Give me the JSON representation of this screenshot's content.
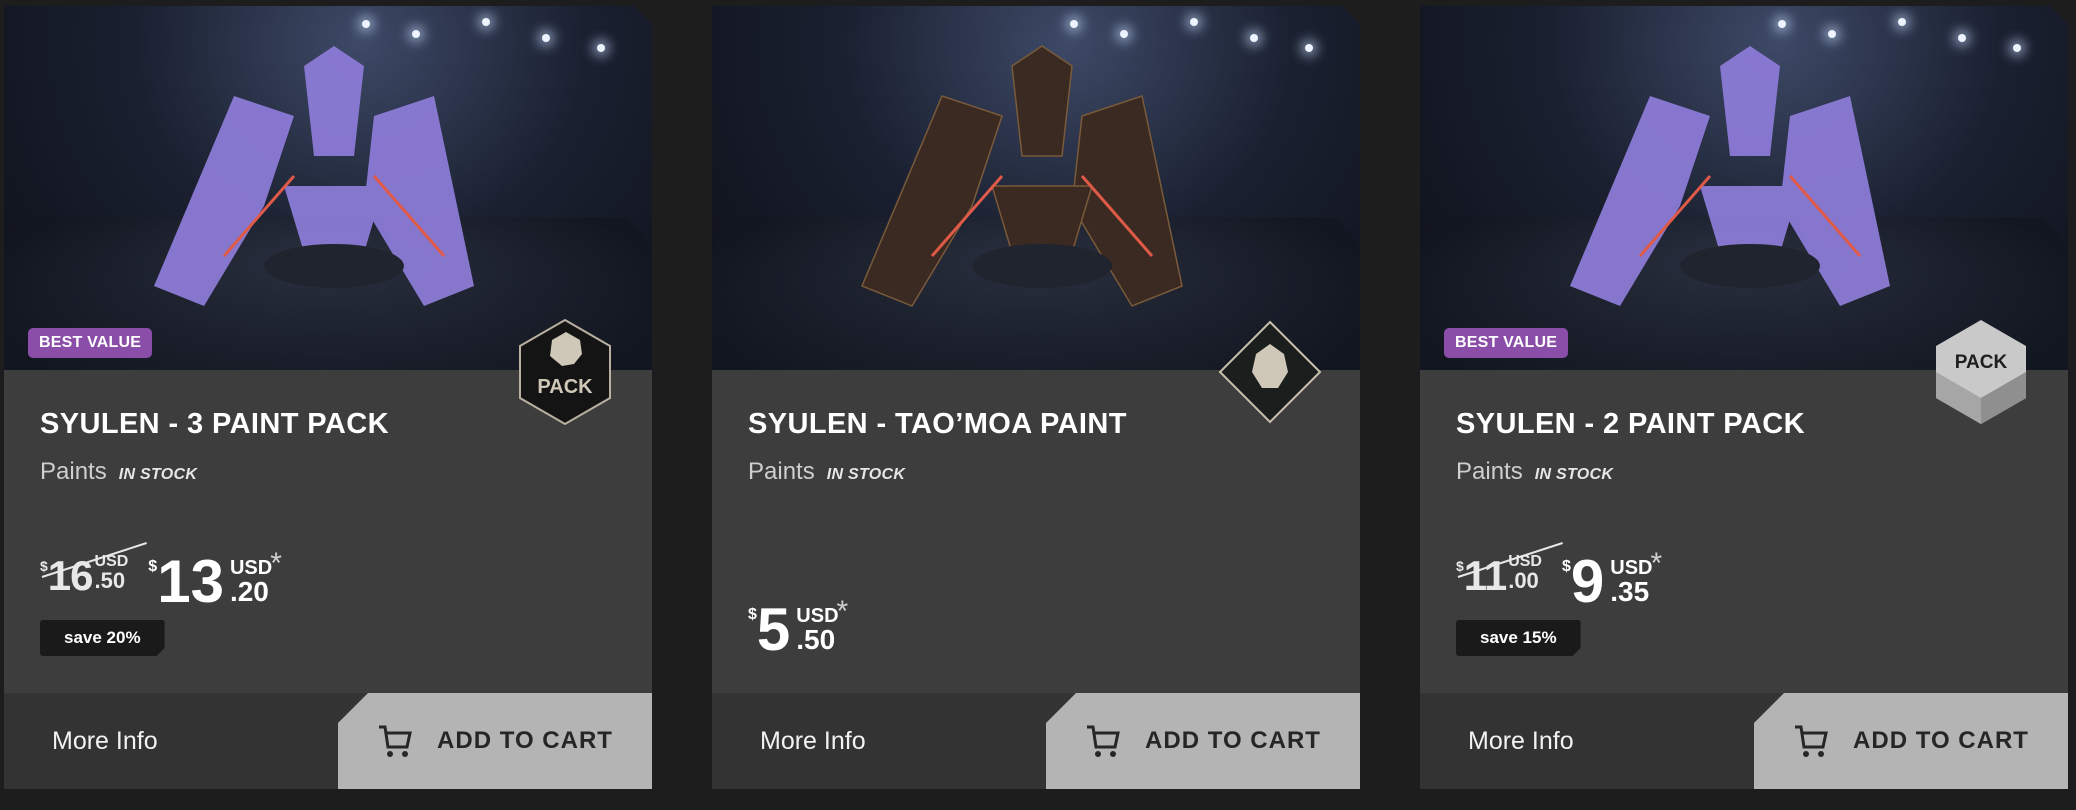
{
  "cards": [
    {
      "badge": "BEST VALUE",
      "emblem_text": "PACK",
      "title": "SYULEN - 3 PAINT PACK",
      "category": "Paints",
      "stock": "IN STOCK",
      "old_price": {
        "symbol": "$",
        "int": "16",
        "currency": "USD",
        "cents": ".50"
      },
      "price": {
        "symbol": "$",
        "int": "13",
        "currency": "USD",
        "cents": ".20",
        "note": "*"
      },
      "save": "save 20%",
      "more_info": "More Info",
      "add_to_cart": "ADD TO CART",
      "ship_color": "#8c7bd6"
    },
    {
      "badge": "",
      "emblem_text": "",
      "title": "SYULEN - TAO’MOA PAINT",
      "category": "Paints",
      "stock": "IN STOCK",
      "price": {
        "symbol": "$",
        "int": "5",
        "currency": "USD",
        "cents": ".50",
        "note": "*"
      },
      "more_info": "More Info",
      "add_to_cart": "ADD TO CART",
      "ship_color": "#3a2a22"
    },
    {
      "badge": "BEST VALUE",
      "emblem_text": "PACK",
      "title": "SYULEN - 2 PAINT PACK",
      "category": "Paints",
      "stock": "IN STOCK",
      "old_price": {
        "symbol": "$",
        "int": "11",
        "currency": "USD",
        "cents": ".00"
      },
      "price": {
        "symbol": "$",
        "int": "9",
        "currency": "USD",
        "cents": ".35",
        "note": "*"
      },
      "save": "save 15%",
      "more_info": "More Info",
      "add_to_cart": "ADD TO CART",
      "ship_color": "#8c7bd6"
    }
  ],
  "colors": {
    "badge": "#8a4ea8",
    "card_bg": "#3d3d3d",
    "footer_bg": "#333333",
    "cart_button": "#b4b4b4",
    "page_bg": "#1d1d1d"
  },
  "icons": {
    "pack_emblem": "lion-hexagon-icon",
    "paint_emblem": "lion-diamond-icon",
    "pack_silver": "silver-hexagon-icon",
    "cart": "cart-icon"
  }
}
